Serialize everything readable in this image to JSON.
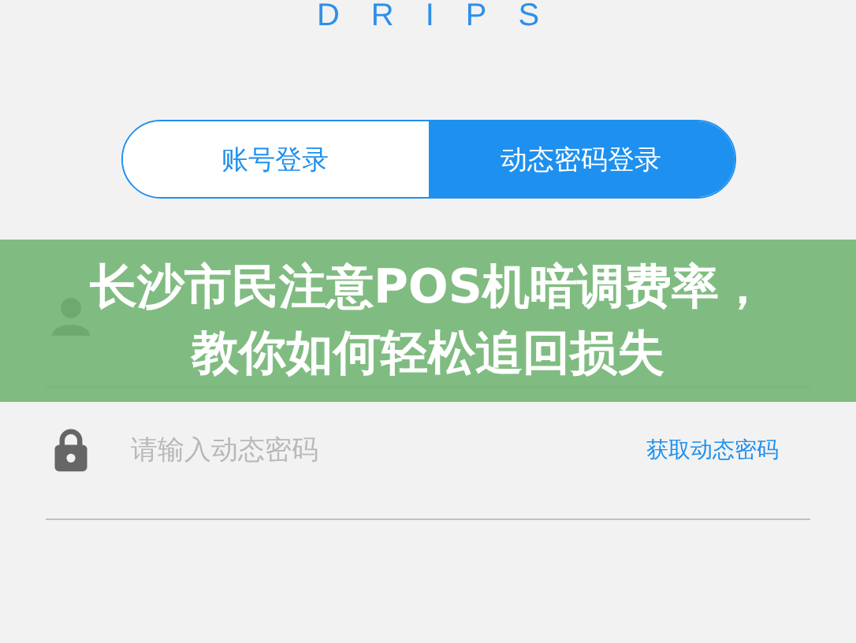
{
  "logo": "DRIPS",
  "tabs": [
    {
      "label": "账号登录",
      "selected": false
    },
    {
      "label": "动态密码登录",
      "selected": true
    }
  ],
  "fields": [
    {
      "kind": "phone"
    },
    {
      "kind": "code",
      "placeholder": "请输入动态密码",
      "action": "获取动态密码"
    }
  ],
  "banner": {
    "title": "长沙市民注意POS机暗调费率，教你如何轻松追回损失"
  }
}
